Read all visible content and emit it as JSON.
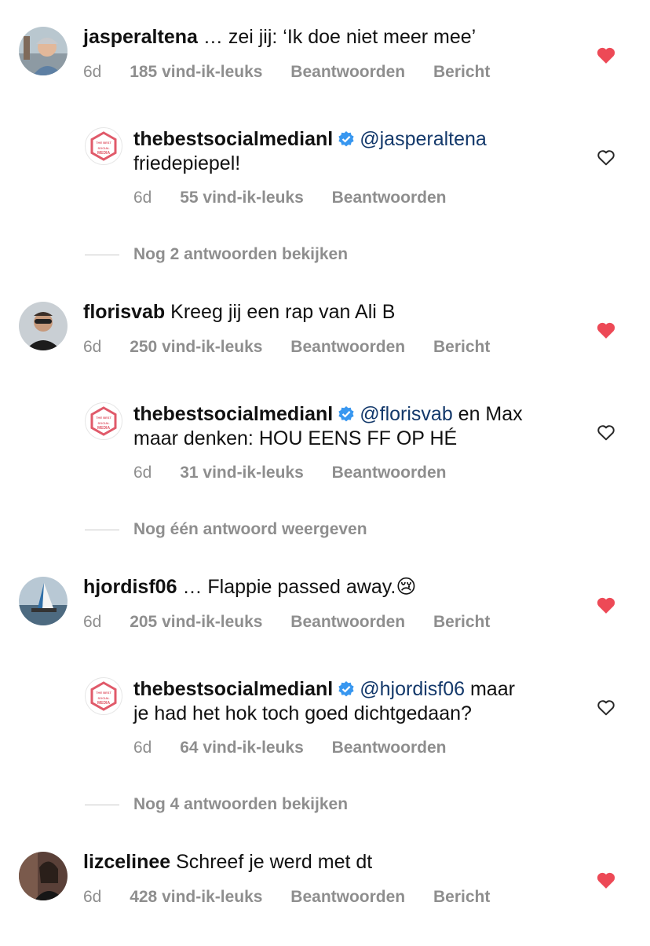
{
  "colors": {
    "heart_liked": "#ed4956",
    "meta_gray": "#8e8e8e",
    "mention": "#14396b",
    "verified": "#3897f0",
    "brand_red": "#e05a6a"
  },
  "comments": [
    {
      "username": "jasperaltena",
      "text": "… zei jij: ‘Ik doe niet meer mee’",
      "time": "6d",
      "likes": "185 vind-ik-leuks",
      "reply": "Beantwoorden",
      "message": "Bericht",
      "liked": true,
      "reply_item": {
        "username": "thebestsocialmedianl",
        "mention": "@jasperaltena",
        "text_line1_rest": "",
        "text_line2": "friedepiepel!",
        "time": "6d",
        "likes": "55 vind-ik-leuks",
        "reply": "Beantwoorden",
        "liked": false
      },
      "more_replies": "Nog 2 antwoorden bekijken"
    },
    {
      "username": "florisvab",
      "text": "Kreeg jij een rap van Ali B",
      "time": "6d",
      "likes": "250 vind-ik-leuks",
      "reply": "Beantwoorden",
      "message": "Bericht",
      "liked": true,
      "reply_item": {
        "username": "thebestsocialmedianl",
        "mention": "@florisvab",
        "text_line1_rest": " en Max",
        "text_line2": "maar denken: HOU EENS FF OP HÉ",
        "time": "6d",
        "likes": "31 vind-ik-leuks",
        "reply": "Beantwoorden",
        "liked": false
      },
      "more_replies": "Nog één antwoord weergeven"
    },
    {
      "username": "hjordisf06",
      "text": "… Flappie passed away.",
      "emoji": "😢",
      "time": "6d",
      "likes": "205 vind-ik-leuks",
      "reply": "Beantwoorden",
      "message": "Bericht",
      "liked": true,
      "reply_item": {
        "username": "thebestsocialmedianl",
        "mention": "@hjordisf06",
        "text_line1_rest": " maar",
        "text_line2": "je had het hok toch goed dichtgedaan?",
        "time": "6d",
        "likes": "64 vind-ik-leuks",
        "reply": "Beantwoorden",
        "liked": false
      },
      "more_replies": "Nog 4 antwoorden bekijken"
    },
    {
      "username": "lizcelinee",
      "text": "Schreef je werd met dt",
      "time": "6d",
      "likes": "428 vind-ik-leuks",
      "reply": "Beantwoorden",
      "message": "Bericht",
      "liked": true
    }
  ],
  "brand_logo_text": [
    "THE",
    "BEST",
    "SOCIAL",
    "MEDIA"
  ]
}
